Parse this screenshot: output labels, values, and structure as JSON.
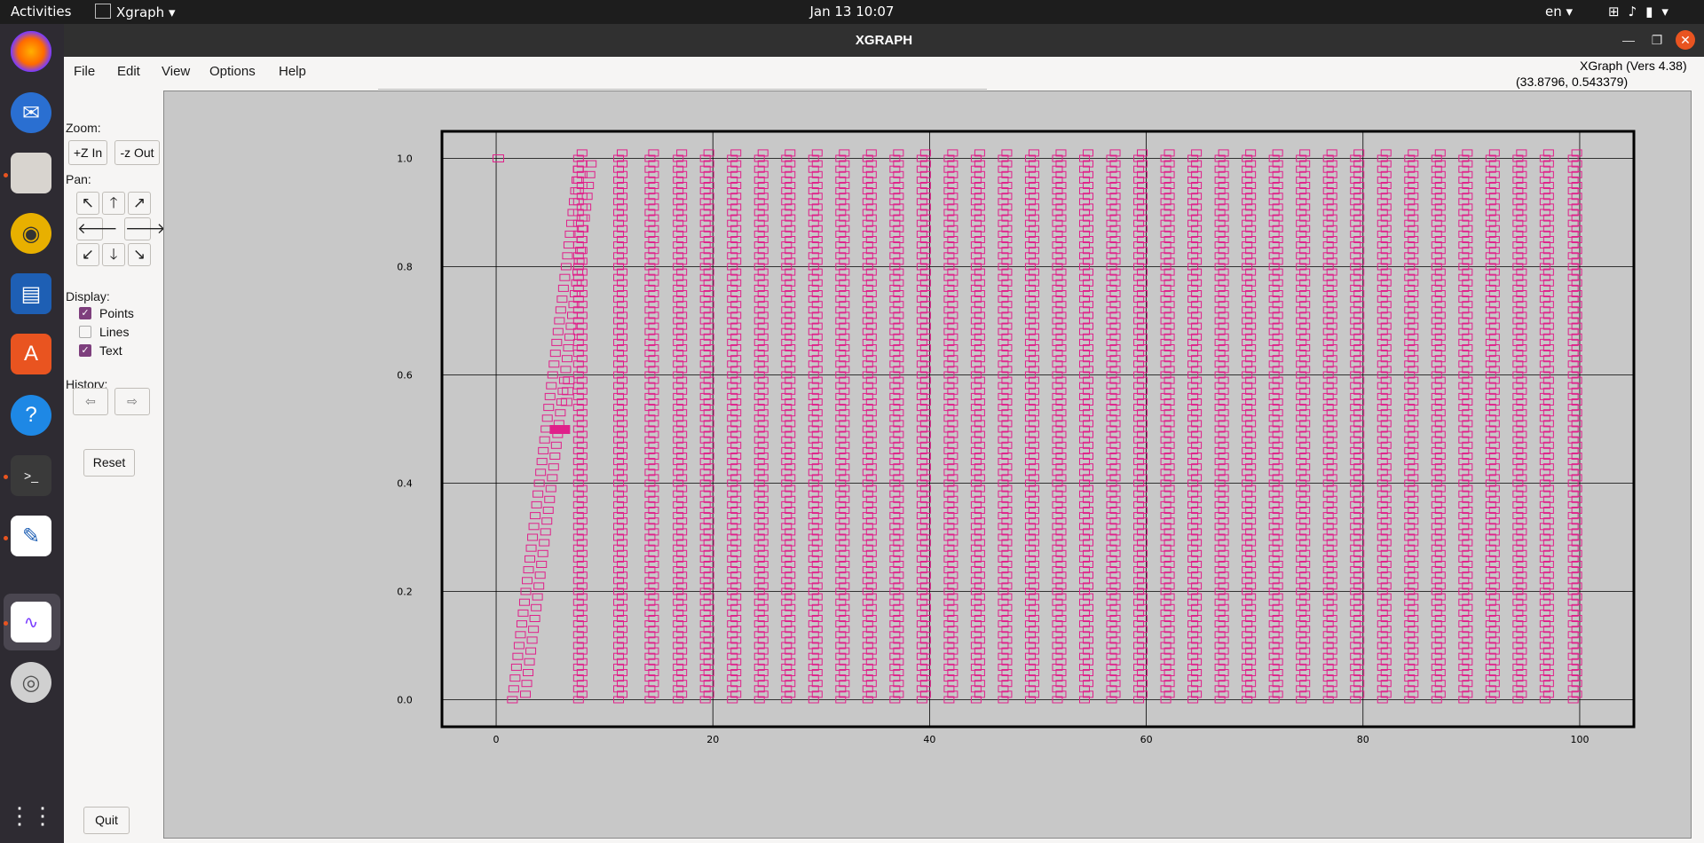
{
  "topbar": {
    "activities": "Activities",
    "app_name": "Xgraph",
    "clock": "Jan 13  10:07",
    "lang": "en"
  },
  "window": {
    "title": "XGRAPH",
    "version": "XGraph (Vers 4.38)",
    "cursor_coords": "(33.8796, 0.543379)"
  },
  "menu": [
    "File",
    "Edit",
    "View",
    "Options",
    "Help"
  ],
  "panel": {
    "zoom_label": "Zoom:",
    "zoom_in": "+Z In",
    "zoom_out": "-z Out",
    "pan_label": "Pan:",
    "display_label": "Display:",
    "points": "Points",
    "lines": "Lines",
    "text": "Text",
    "points_checked": true,
    "lines_checked": false,
    "text_checked": true,
    "history_label": "History:",
    "reset": "Reset",
    "quit": "Quit"
  },
  "icons": {
    "zoom_out_dir": [
      "arrow-up-left-icon",
      "arrow-up-icon",
      "arrow-up-right-icon",
      "arrow-left-icon",
      "arrow-right-icon",
      "arrow-down-left-icon",
      "arrow-down-icon",
      "arrow-down-right-icon"
    ],
    "history": [
      "history-back-icon",
      "history-forward-icon"
    ]
  },
  "colors": {
    "marker": "#e0208a",
    "plot_bg": "#c8c8c8",
    "accent": "#7e3f7d"
  },
  "chart_data": {
    "type": "scatter",
    "series_marker": "square",
    "xlim": [
      -5,
      105
    ],
    "ylim": [
      -0.05,
      1.05
    ],
    "x_ticks": [
      0,
      20,
      40,
      60,
      80,
      100
    ],
    "x_tick_labels": [
      "0",
      "20",
      "40",
      "60",
      "80",
      "100"
    ],
    "y_ticks": [
      0.0,
      0.2,
      0.4,
      0.6,
      0.8,
      1.0
    ],
    "y_tick_labels": [
      "0.0",
      "0.2",
      "0.4",
      "0.6",
      "0.8",
      "1.0"
    ],
    "grid": true,
    "columns_x": [
      7.6,
      11.3,
      14.2,
      16.8,
      19.3,
      21.8,
      24.3,
      26.8,
      29.3,
      31.8,
      34.3,
      36.8,
      39.3,
      41.8,
      44.3,
      46.8,
      49.3,
      51.8,
      54.3,
      56.8,
      59.3,
      61.8,
      64.3,
      66.8,
      69.3,
      71.8,
      74.3,
      76.8,
      79.3,
      81.8,
      84.3,
      86.8,
      89.3,
      91.8,
      94.3,
      96.8,
      99.4
    ],
    "points": [
      [
        0.2,
        1.0
      ],
      [
        5.8,
        0.5
      ],
      [
        6.0,
        0.5
      ],
      [
        6.5,
        0.55
      ],
      [
        6.6,
        0.57
      ],
      [
        6.7,
        0.59
      ]
    ]
  }
}
